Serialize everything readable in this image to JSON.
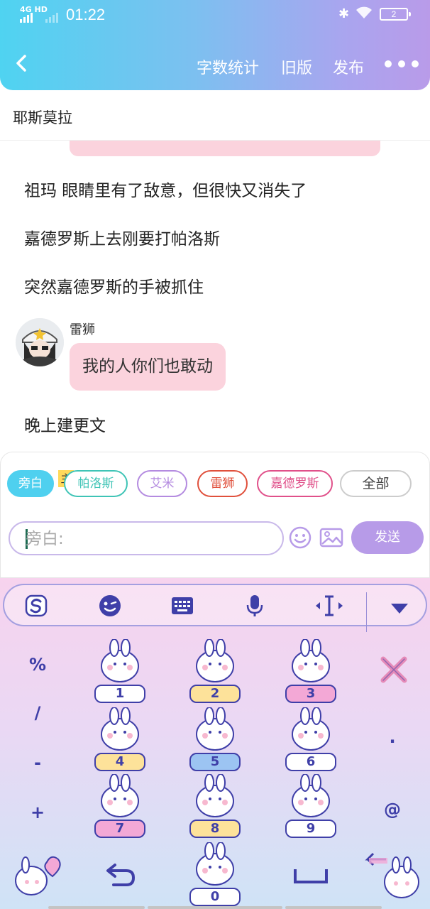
{
  "status": {
    "network": "4G HD",
    "time": "01:22",
    "battery": "2"
  },
  "toolbar": {
    "word_count": "字数统计",
    "old_version": "旧版",
    "publish": "发布"
  },
  "doc": {
    "title": "耶斯莫拉"
  },
  "story": {
    "paragraphs": [
      "祖玛 眼睛里有了敌意，但很快又消失了",
      "嘉德罗斯上去刚要打帕洛斯",
      "突然嘉德罗斯的手被抓住"
    ],
    "dialogue": {
      "speaker": "雷狮",
      "text": "我的人你们也敢动"
    },
    "last_paragraph": "晚上建更文"
  },
  "characters": {
    "host_badge": "主",
    "chips": [
      {
        "label": "旁白",
        "color": "#4fd0ef",
        "active": true
      },
      {
        "label": "帕洛斯",
        "color": "#3fc4b6",
        "active": false
      },
      {
        "label": "艾米",
        "color": "#b48be0",
        "active": false
      },
      {
        "label": "雷狮",
        "color": "#e0503c",
        "active": false
      },
      {
        "label": "嘉德罗斯",
        "color": "#e0508a",
        "active": false
      },
      {
        "label": "全部",
        "color": "#cccccc",
        "active": false
      }
    ]
  },
  "composer": {
    "placeholder": "旁白:",
    "send_label": "发送"
  },
  "keyboard": {
    "left_symbols": [
      "%",
      "/",
      "-",
      "+"
    ],
    "right_symbols": [
      ".",
      "@"
    ],
    "keys": [
      "1",
      "2",
      "3",
      "4",
      "5",
      "6",
      "7",
      "8",
      "9",
      "0"
    ],
    "accent": "#3f3fa8"
  }
}
